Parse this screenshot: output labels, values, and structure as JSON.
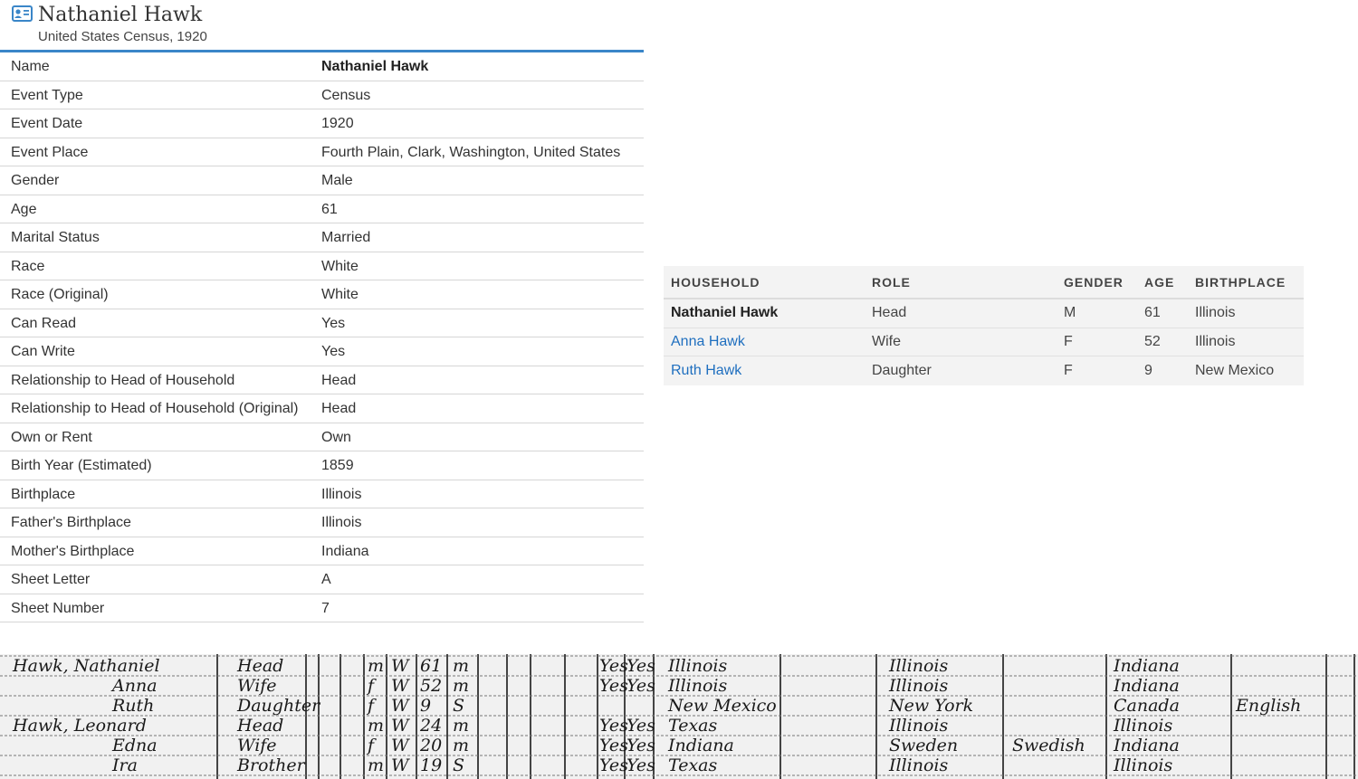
{
  "header": {
    "title": "Nathaniel Hawk",
    "subtitle": "United States Census, 1920",
    "icon": "person-card-icon"
  },
  "facts": [
    {
      "label": "Name",
      "value": "Nathaniel Hawk"
    },
    {
      "label": "Event Type",
      "value": "Census"
    },
    {
      "label": "Event Date",
      "value": "1920"
    },
    {
      "label": "Event Place",
      "value": "Fourth Plain, Clark, Washington, United States"
    },
    {
      "label": "Gender",
      "value": "Male"
    },
    {
      "label": "Age",
      "value": "61"
    },
    {
      "label": "Marital Status",
      "value": "Married"
    },
    {
      "label": "Race",
      "value": "White"
    },
    {
      "label": "Race (Original)",
      "value": "White"
    },
    {
      "label": "Can Read",
      "value": "Yes"
    },
    {
      "label": "Can Write",
      "value": "Yes"
    },
    {
      "label": "Relationship to Head of Household",
      "value": "Head"
    },
    {
      "label": "Relationship to Head of Household (Original)",
      "value": "Head"
    },
    {
      "label": "Own or Rent",
      "value": "Own"
    },
    {
      "label": "Birth Year (Estimated)",
      "value": "1859"
    },
    {
      "label": "Birthplace",
      "value": "Illinois"
    },
    {
      "label": "Father's Birthplace",
      "value": "Illinois"
    },
    {
      "label": "Mother's Birthplace",
      "value": "Indiana"
    },
    {
      "label": "Sheet Letter",
      "value": "A"
    },
    {
      "label": "Sheet Number",
      "value": "7"
    }
  ],
  "household": {
    "columns": [
      "HOUSEHOLD",
      "ROLE",
      "GENDER",
      "AGE",
      "BIRTHPLACE"
    ],
    "rows": [
      {
        "name": "Nathaniel Hawk",
        "role": "Head",
        "gender": "M",
        "age": "61",
        "birthplace": "Illinois"
      },
      {
        "name": "Anna Hawk",
        "role": "Wife",
        "gender": "F",
        "age": "52",
        "birthplace": "Illinois"
      },
      {
        "name": "Ruth Hawk",
        "role": "Daughter",
        "gender": "F",
        "age": "9",
        "birthplace": "New Mexico"
      }
    ]
  },
  "scan": {
    "rows": [
      {
        "name": "Hawk, Nathaniel",
        "rel": "Head",
        "sex": "m",
        "race": "W",
        "age": "61",
        "ms": "m",
        "read": "Yes",
        "write": "Yes",
        "bp": "Illinois",
        "fbp": "Illinois",
        "mtongue": "",
        "mbp": "Indiana",
        "lang": ""
      },
      {
        "name": "Anna",
        "rel": "Wife",
        "sex": "f",
        "race": "W",
        "age": "52",
        "ms": "m",
        "read": "Yes",
        "write": "Yes",
        "bp": "Illinois",
        "fbp": "Illinois",
        "mtongue": "",
        "mbp": "Indiana",
        "lang": ""
      },
      {
        "name": "Ruth",
        "rel": "Daughter",
        "sex": "f",
        "race": "W",
        "age": "9",
        "ms": "S",
        "read": "",
        "write": "",
        "bp": "New Mexico",
        "fbp": "New York",
        "mtongue": "",
        "mbp": "Canada",
        "lang": "English"
      },
      {
        "name": "Hawk, Leonard",
        "rel": "Head",
        "sex": "m",
        "race": "W",
        "age": "24",
        "ms": "m",
        "read": "Yes",
        "write": "Yes",
        "bp": "Texas",
        "fbp": "Illinois",
        "mtongue": "",
        "mbp": "Illinois",
        "lang": ""
      },
      {
        "name": "Edna",
        "rel": "Wife",
        "sex": "f",
        "race": "W",
        "age": "20",
        "ms": "m",
        "read": "Yes",
        "write": "Yes",
        "bp": "Indiana",
        "fbp": "Sweden",
        "mtongue": "Swedish",
        "mbp": "Indiana",
        "lang": ""
      },
      {
        "name": "Ira",
        "rel": "Brother",
        "sex": "m",
        "race": "W",
        "age": "19",
        "ms": "S",
        "read": "Yes",
        "write": "Yes",
        "bp": "Texas",
        "fbp": "Illinois",
        "mtongue": "",
        "mbp": "Illinois",
        "lang": ""
      }
    ]
  }
}
